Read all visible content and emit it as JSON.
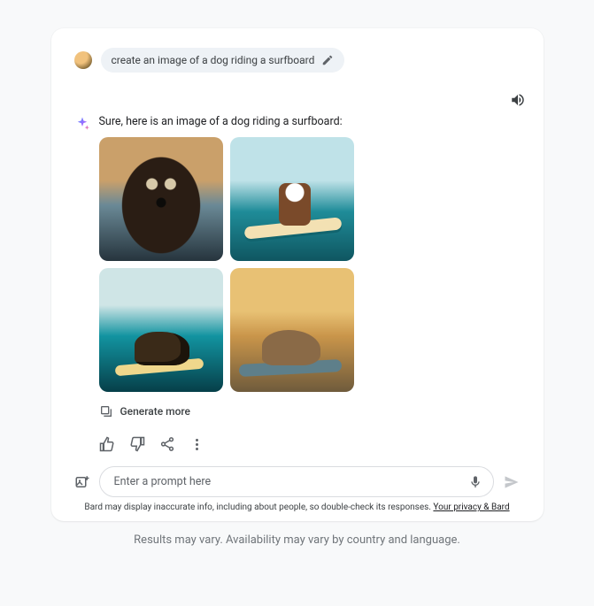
{
  "user": {
    "prompt": "create an image of a dog riding a surfboard"
  },
  "assistant": {
    "intro": "Sure, here is an image of a dog riding a surfboard:",
    "generate_more_label": "Generate more"
  },
  "composer": {
    "placeholder": "Enter a prompt here"
  },
  "disclaimer": {
    "text": "Bard may display inaccurate info, including about people, so double-check its responses. ",
    "link_label": "Your privacy & Bard"
  },
  "footer": {
    "text": "Results may vary. Availability may vary by country and language."
  }
}
